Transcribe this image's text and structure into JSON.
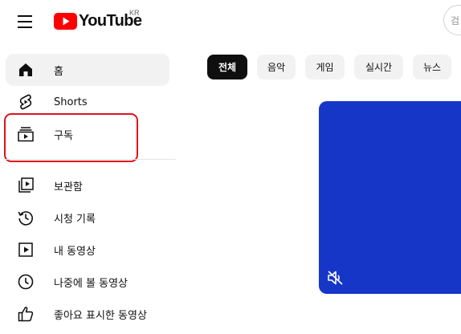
{
  "header": {
    "logo_text": "YouTube",
    "country_code": "KR",
    "search_placeholder_fragment": "검"
  },
  "sidebar": {
    "items": [
      {
        "label": "홈",
        "icon": "home-icon",
        "active": true
      },
      {
        "label": "Shorts",
        "icon": "shorts-icon",
        "active": false
      },
      {
        "label": "구독",
        "icon": "subscriptions-icon",
        "active": false,
        "highlighted": true
      },
      {
        "label": "보관함",
        "icon": "library-icon",
        "active": false
      },
      {
        "label": "시청 기록",
        "icon": "history-icon",
        "active": false
      },
      {
        "label": "내 동영상",
        "icon": "your-videos-icon",
        "active": false
      },
      {
        "label": "나중에 볼 동영상",
        "icon": "watch-later-icon",
        "active": false
      },
      {
        "label": "좋아요 표시한 동영상",
        "icon": "liked-videos-icon",
        "active": false
      }
    ]
  },
  "chips": [
    {
      "label": "전체",
      "active": true
    },
    {
      "label": "음악",
      "active": false
    },
    {
      "label": "게임",
      "active": false
    },
    {
      "label": "실시간",
      "active": false
    },
    {
      "label": "뉴스",
      "active": false
    }
  ],
  "video": {
    "muted": true,
    "mute_icon": "volume-off-icon"
  },
  "colors": {
    "brand_red": "#ff0000",
    "highlight_red": "#e0121b",
    "video_bg": "#1636c8",
    "chip_active_bg": "#0f0f0f",
    "chip_bg": "#f2f2f2"
  }
}
